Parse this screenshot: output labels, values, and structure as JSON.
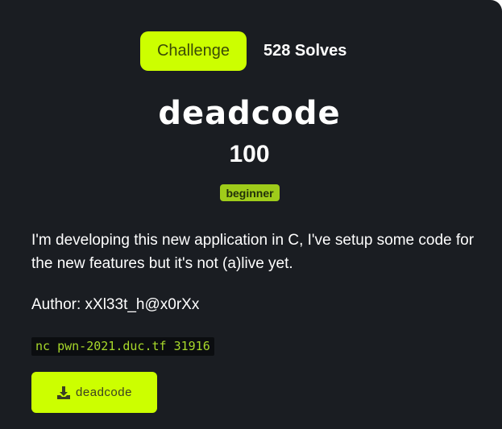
{
  "header": {
    "tab_label": "Challenge",
    "solves_text": "528 Solves"
  },
  "challenge": {
    "name": "deadcode",
    "points": "100",
    "tag": "beginner",
    "description": "I'm developing this new application in C, I've setup some code for the new features but it's not (a)live yet.",
    "author": "Author: xXl33t_h@x0rXx",
    "connection": "nc pwn-2021.duc.tf 31916"
  },
  "file": {
    "label": "deadcode",
    "icon": "download-icon"
  },
  "colors": {
    "background": "#1a1d22",
    "accent": "#ccff00",
    "tag": "#9fcc1a",
    "code_text": "#a7d82a"
  }
}
